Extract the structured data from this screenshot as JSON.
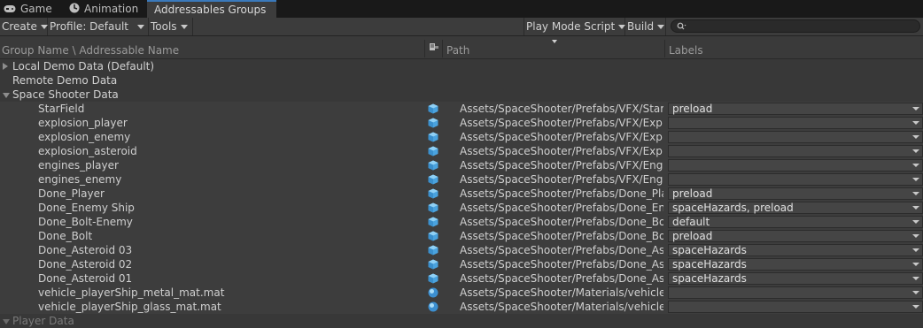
{
  "tabs": [
    {
      "label": "Game",
      "icon": "gamepad-icon"
    },
    {
      "label": "Animation",
      "icon": "animation-icon"
    },
    {
      "label": "Addressables Groups",
      "active": true
    }
  ],
  "toolbar": {
    "create": "Create",
    "profile": "Profile: Default",
    "tools": "Tools",
    "play_mode_script": "Play Mode Script",
    "build": "Build",
    "search_placeholder": ""
  },
  "header": {
    "group_name": "Group Name \\ Addressable Name",
    "path": "Path",
    "labels": "Labels"
  },
  "groups": [
    {
      "name": "Local Demo Data (Default)",
      "expanded": false
    },
    {
      "name": "Remote Demo Data",
      "expanded": false
    },
    {
      "name": "Space Shooter Data",
      "expanded": true
    },
    {
      "name": "Player Data",
      "expanded": true
    }
  ],
  "entries": [
    {
      "name": "StarField",
      "icon": "prefab-icon",
      "path": "Assets/SpaceShooter/Prefabs/VFX/Starfi",
      "labels": "preload"
    },
    {
      "name": "explosion_player",
      "icon": "prefab-icon",
      "path": "Assets/SpaceShooter/Prefabs/VFX/Explo",
      "labels": ""
    },
    {
      "name": "explosion_enemy",
      "icon": "prefab-icon",
      "path": "Assets/SpaceShooter/Prefabs/VFX/Explo",
      "labels": ""
    },
    {
      "name": "explosion_asteroid",
      "icon": "prefab-icon",
      "path": "Assets/SpaceShooter/Prefabs/VFX/Explo",
      "labels": ""
    },
    {
      "name": "engines_player",
      "icon": "prefab-icon",
      "path": "Assets/SpaceShooter/Prefabs/VFX/Engin",
      "labels": ""
    },
    {
      "name": "engines_enemy",
      "icon": "prefab-icon",
      "path": "Assets/SpaceShooter/Prefabs/VFX/Engin",
      "labels": ""
    },
    {
      "name": "Done_Player",
      "icon": "prefab-icon",
      "path": "Assets/SpaceShooter/Prefabs/Done_Play",
      "labels": "preload"
    },
    {
      "name": "Done_Enemy Ship",
      "icon": "prefab-icon",
      "path": "Assets/SpaceShooter/Prefabs/Done_Ene",
      "labels": "spaceHazards, preload"
    },
    {
      "name": "Done_Bolt-Enemy",
      "icon": "prefab-icon",
      "path": "Assets/SpaceShooter/Prefabs/Done_Bolt",
      "labels": "default"
    },
    {
      "name": "Done_Bolt",
      "icon": "prefab-icon",
      "path": "Assets/SpaceShooter/Prefabs/Done_Bolt",
      "labels": "preload"
    },
    {
      "name": "Done_Asteroid 03",
      "icon": "prefab-icon",
      "path": "Assets/SpaceShooter/Prefabs/Done_Aste",
      "labels": "spaceHazards"
    },
    {
      "name": "Done_Asteroid 02",
      "icon": "prefab-icon",
      "path": "Assets/SpaceShooter/Prefabs/Done_Aste",
      "labels": "spaceHazards"
    },
    {
      "name": "Done_Asteroid 01",
      "icon": "prefab-icon",
      "path": "Assets/SpaceShooter/Prefabs/Done_Aste",
      "labels": "spaceHazards"
    },
    {
      "name": "vehicle_playerShip_metal_mat.mat",
      "icon": "material-icon",
      "path": "Assets/SpaceShooter/Materials/vehicle_p",
      "labels": ""
    },
    {
      "name": "vehicle_playerShip_glass_mat.mat",
      "icon": "material-icon",
      "path": "Assets/SpaceShooter/Materials/vehicle_p",
      "labels": ""
    }
  ],
  "colors": {
    "background": "#383838",
    "tabbar": "#191919",
    "accent": "#3a79bb",
    "asset_icon": "#5bb2e6"
  }
}
